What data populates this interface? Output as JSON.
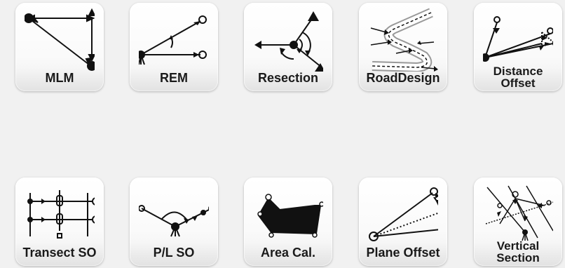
{
  "menu": {
    "tiles": [
      {
        "label": "MLM",
        "icon": "mlm-icon"
      },
      {
        "label": "REM",
        "icon": "rem-icon"
      },
      {
        "label": "Resection",
        "icon": "resection-icon"
      },
      {
        "label": "RoadDesign",
        "icon": "road-design-icon"
      },
      {
        "label": "Distance\nOffset",
        "icon": "distance-offset-icon"
      },
      {
        "label": "Transect SO",
        "icon": "transect-so-icon"
      },
      {
        "label": "P/L SO",
        "icon": "pl-so-icon"
      },
      {
        "label": "Area Cal.",
        "icon": "area-calculation-icon"
      },
      {
        "label": "Plane Offset",
        "icon": "plane-offset-icon"
      },
      {
        "label": "Vertical\nSection",
        "icon": "vertical-section-icon"
      }
    ]
  },
  "colors": {
    "background": "#f1f1f1",
    "icon_stroke": "#111111",
    "label_text": "#1a1a1a"
  }
}
